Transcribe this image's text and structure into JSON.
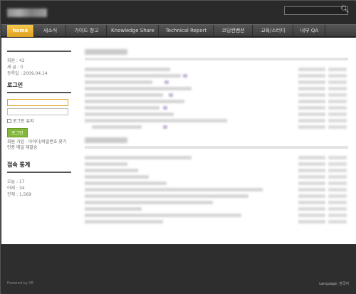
{
  "nav": {
    "items": [
      "home",
      "새소식",
      "가이드 창고",
      "Knowledge Share",
      "Technical Report",
      "코딩컨벤션",
      "교육/스터디",
      "내부 QA"
    ]
  },
  "sidebar": {
    "member_info": [
      "회원 : 42",
      "새 글 : 0",
      "등록일 : 2009.04.14"
    ],
    "login_title": "로그인",
    "remember_label": "로그인 유지",
    "login_button": "로그인",
    "help_lines": [
      "회원 가입 · 아이디/비밀번호 찾기",
      "인증 메일 재발송"
    ],
    "stats_title": "접속 통계",
    "stats": [
      "오늘 : 17",
      "어제 : 34",
      "전체 : 1,569"
    ]
  },
  "footer": {
    "powered": "Powered by XE",
    "language": "Language: 한국어"
  },
  "colors": {
    "accent": "#e0a020",
    "button": "#84b83a",
    "chrome": "#2b2b2b"
  }
}
